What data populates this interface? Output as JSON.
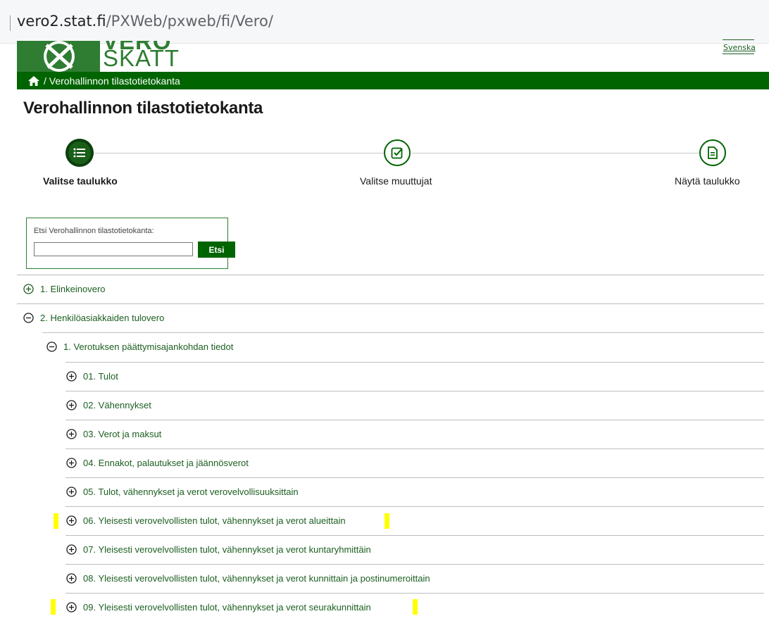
{
  "browser": {
    "url_domain": "vero2.stat.fi",
    "url_path": "/PXWeb/pxweb/fi/Vero/"
  },
  "logo": {
    "top_text": "VERO",
    "word": "SKATT"
  },
  "language_link": "Svenska",
  "breadcrumb": {
    "text": "/ Verohallinnon tilastotietokanta"
  },
  "page_title": "Verohallinnon tilastotietokanta",
  "steps": [
    {
      "label": "Valitse taulukko"
    },
    {
      "label": "Valitse muuttujat"
    },
    {
      "label": "Näytä taulukko"
    }
  ],
  "search": {
    "label": "Etsi Verohallinnon tilastotietokanta:",
    "value": "",
    "button": "Etsi"
  },
  "tree": [
    {
      "label": "1. Elinkeinovero",
      "state": "collapsed"
    },
    {
      "label": "2. Henkilöasiakkaiden tulovero",
      "state": "expanded"
    },
    {
      "label": "1. Verotuksen päättymisajankohdan tiedot",
      "state": "expanded"
    },
    {
      "label": "01. Tulot",
      "state": "collapsed"
    },
    {
      "label": "02. Vähennykset",
      "state": "collapsed"
    },
    {
      "label": "03. Verot ja maksut",
      "state": "collapsed"
    },
    {
      "label": "04. Ennakot, palautukset ja jäännösverot",
      "state": "collapsed"
    },
    {
      "label": "05. Tulot, vähennykset ja verot verovelvollisuuksittain",
      "state": "collapsed"
    },
    {
      "label": "06. Yleisesti verovelvollisten tulot, vähennykset ja verot alueittain",
      "state": "collapsed",
      "highlighted": true
    },
    {
      "label": "07. Yleisesti verovelvollisten tulot, vähennykset ja verot kuntaryhmittäin",
      "state": "collapsed"
    },
    {
      "label": "08. Yleisesti verovelvollisten tulot, vähennykset ja verot kunnittain ja postinumeroittain",
      "state": "collapsed"
    },
    {
      "label": "09. Yleisesti verovelvollisten tulot, vähennykset ja verot seurakunnittain",
      "state": "collapsed",
      "highlighted": true
    }
  ],
  "colors": {
    "brand_green": "#006400",
    "link_green": "#1b5e20",
    "highlight": "#ffff00"
  }
}
